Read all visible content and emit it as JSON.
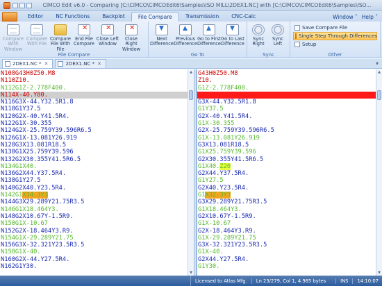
{
  "window": {
    "title": "CIMCO Edit v6.0 - Comparing [C:\\CIMCO\\CIMCOEdit6\\Samples\\ISO MILL\\2DEX1.NC] with [C:\\CIMCO\\CIMCOEdit6\\Samples\\ISO..."
  },
  "ribbon_tabs": [
    {
      "label": "Editor"
    },
    {
      "label": "NC Functions"
    },
    {
      "label": "Backplot"
    },
    {
      "label": "File Compare"
    },
    {
      "label": "Transmission"
    },
    {
      "label": "CNC-Calc"
    }
  ],
  "help_area": {
    "window_label": "Window ˅",
    "help_label": "Help ˅"
  },
  "ribbon": {
    "file_compare": {
      "title": "File Compare",
      "buttons": [
        {
          "label": "Compare With Window"
        },
        {
          "label": "Compare With File"
        },
        {
          "label": "Compare File With File"
        },
        {
          "label": "End File Compare"
        },
        {
          "label": "Close Left Window"
        },
        {
          "label": "Close Right Window"
        }
      ]
    },
    "go_to": {
      "title": "Go To",
      "buttons": [
        {
          "label": "Next Difference"
        },
        {
          "label": "Previous Difference"
        },
        {
          "label": "Go to First Difference"
        },
        {
          "label": "Go to Last Difference"
        }
      ]
    },
    "sync": {
      "title": "Sync",
      "buttons": [
        {
          "label": "Sync Right"
        },
        {
          "label": "Sync Left"
        }
      ]
    },
    "other": {
      "title": "Other",
      "items": [
        {
          "label": "Save Compare File"
        },
        {
          "label": "Single Step Through Differences"
        },
        {
          "label": "Setup"
        }
      ]
    }
  },
  "doc_tabs": [
    {
      "label": "2DEX1.NC *"
    },
    {
      "label": "2DEX1.NC *"
    }
  ],
  "colors": {
    "black": "#111111",
    "red": "#cc0000",
    "green": "#55b82e",
    "blue": "#1a2bb0",
    "yellow_hl": "#e8ff3a",
    "orange_hl": "#f5a61f",
    "red_row": "#ff1a1a",
    "gray_row": "#cfcfcf"
  },
  "left_lines": [
    {
      "text": "N108G43H0Z50.M8",
      "color": "red"
    },
    {
      "text": "N110Z10.",
      "color": "red"
    },
    {
      "text": "N112G1Z-2.778F400.",
      "color": "green"
    },
    {
      "text": "N114X-40.Y80.",
      "color": "red",
      "row": "gray"
    },
    {
      "text": "N116G3X-44.Y32.5R1.8",
      "color": "blue"
    },
    {
      "text": "N118G1Y37.5",
      "color": "blue"
    },
    {
      "text": "N120G2X-40.Y41.5R4.",
      "color": "blue"
    },
    {
      "text": "N122G1X-30.355",
      "color": "blue"
    },
    {
      "text": "N124G2X-25.759Y39.596R6.5",
      "color": "blue"
    },
    {
      "text": "N126G1X-13.081Y26.919",
      "color": "blue"
    },
    {
      "text": "N128G3X13.081R18.5",
      "color": "blue"
    },
    {
      "text": "N130G1X25.759Y39.596",
      "color": "blue"
    },
    {
      "text": "N132G2X30.355Y41.5R6.5",
      "color": "blue"
    },
    {
      "text": "N134G1X40.",
      "color": "green"
    },
    {
      "text": "N136G2X44.Y37.5R4.",
      "color": "blue"
    },
    {
      "text": "N138G1Y27.5",
      "color": "blue"
    },
    {
      "text": "N140G2X40.Y23.5R4.",
      "color": "blue"
    },
    {
      "text": "N142G1X34.3Y3",
      "color": "green",
      "hl_from": 6,
      "hl": "orange"
    },
    {
      "text": "N144G3X29.289Y21.75R3.5",
      "color": "blue"
    },
    {
      "text": "N146G1X18.464Y3.",
      "color": "green"
    },
    {
      "text": "N148G2X10.67Y-1.5R9.",
      "color": "blue"
    },
    {
      "text": "N150G1X-10.67",
      "color": "green"
    },
    {
      "text": "N152G2X-18.464Y3.R9.",
      "color": "blue"
    },
    {
      "text": "N154G1X-29.289Y21.75",
      "color": "green"
    },
    {
      "text": "N156G3X-32.321Y23.5R3.5",
      "color": "blue"
    },
    {
      "text": "N158G1X-40.",
      "color": "green"
    },
    {
      "text": "N160G2X-44.Y27.5R4.",
      "color": "blue"
    },
    {
      "text": "N162G1Y30.",
      "color": "blue"
    }
  ],
  "right_lines": [
    {
      "text": "G43H0Z50.M8",
      "color": "red"
    },
    {
      "text": "Z10.",
      "color": "red"
    },
    {
      "text": "G1Z-2.778F400.",
      "color": "green"
    },
    {
      "text": "",
      "color": "red",
      "row": "red"
    },
    {
      "text": "G3X-44.Y32.5R1.8",
      "color": "blue"
    },
    {
      "text": "G1Y37.5",
      "color": "green"
    },
    {
      "text": "G2X-40.Y41.5R4.",
      "color": "blue"
    },
    {
      "text": "G1X-30.355",
      "color": "green"
    },
    {
      "text": "G2X-25.759Y39.596R6.5",
      "color": "blue"
    },
    {
      "text": "G1X-13.081Y26.919",
      "color": "green"
    },
    {
      "text": "G3X13.081R18.5",
      "color": "blue"
    },
    {
      "text": "G1X25.759Y39.596",
      "color": "green"
    },
    {
      "text": "G2X30.355Y41.5R6.5",
      "color": "blue"
    },
    {
      "text": "G1X40.Z20",
      "color": "green",
      "hl_from": 6,
      "hl": "yellow"
    },
    {
      "text": "G2X44.Y37.5R4.",
      "color": "blue"
    },
    {
      "text": "G1Y27.5",
      "color": "green"
    },
    {
      "text": "G2X40.Y23.5R4.",
      "color": "blue"
    },
    {
      "text": "G1X32.3Y3",
      "color": "green",
      "hl_from": 2,
      "hl": "orange"
    },
    {
      "text": "G3X29.289Y21.75R3.5",
      "color": "blue"
    },
    {
      "text": "G1X18.464Y3.",
      "color": "green"
    },
    {
      "text": "G2X10.67Y-1.5R9.",
      "color": "blue"
    },
    {
      "text": "G1X-10.67",
      "color": "green"
    },
    {
      "text": "G2X-18.464Y3.R9.",
      "color": "blue"
    },
    {
      "text": "G1X-29.289Y21.75",
      "color": "green"
    },
    {
      "text": "G3X-32.321Y23.5R3.5",
      "color": "blue"
    },
    {
      "text": "G1X-40.",
      "color": "green"
    },
    {
      "text": "G2X44.Y27.5R4.",
      "color": "blue"
    },
    {
      "text": "G1Y30.",
      "color": "green"
    }
  ],
  "statusbar": {
    "license": "Licensed to Atlas Mfg.",
    "position": "Ln 23/279, Col 1, 4.985 bytes",
    "mode": "INS",
    "time": "14:10:07"
  }
}
